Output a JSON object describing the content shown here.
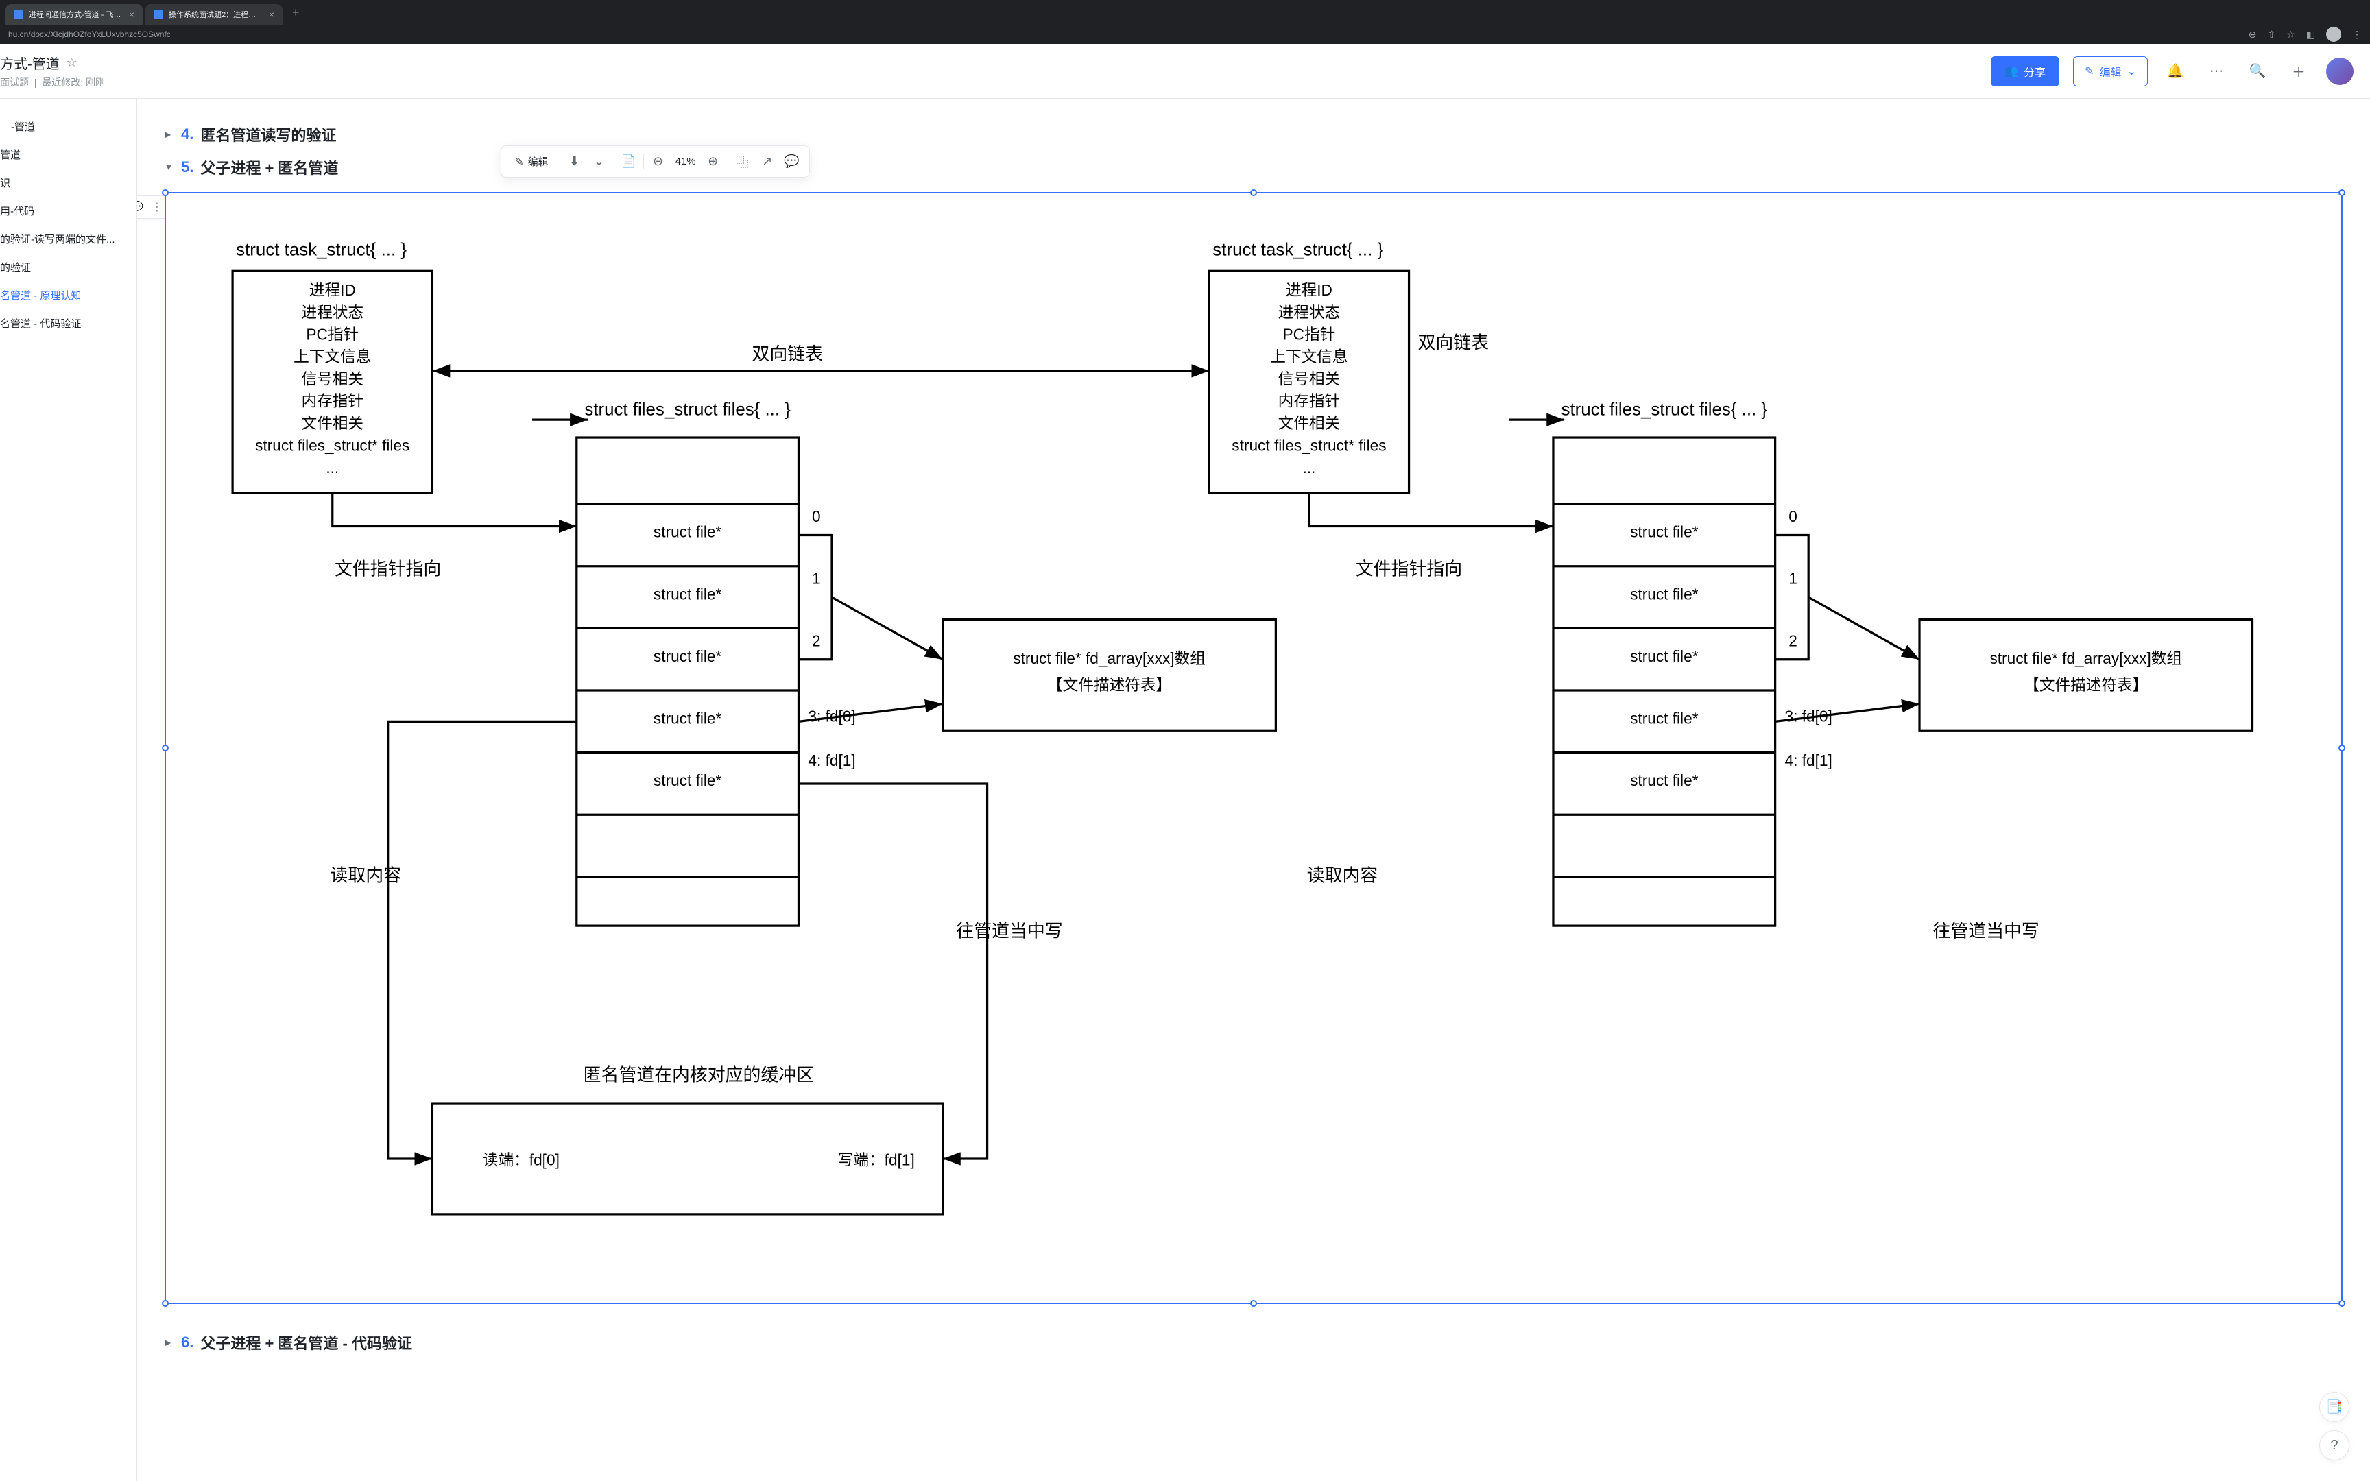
{
  "browser": {
    "tabs": [
      {
        "title": "进程间通信方式-管道 - 飞书云文档",
        "active": true
      },
      {
        "title": "操作系统面试题2：进程间通信方式",
        "active": false
      }
    ],
    "url": "hu.cn/docx/XIcjdhOZfoYxLUxvbhzc5OSwnfc"
  },
  "header": {
    "doc_title": "方式-管道",
    "meta_left": "面试题",
    "meta_right": "最近修改: 刚刚",
    "share": "分享",
    "edit": "编辑"
  },
  "toc": {
    "items": [
      {
        "label": "-管道",
        "active": false
      },
      {
        "label": "管道",
        "active": false
      },
      {
        "label": "识",
        "active": false
      },
      {
        "label": "用-代码",
        "active": false
      },
      {
        "label": "的验证-读写两端的文件...",
        "active": false
      },
      {
        "label": "的验证",
        "active": false
      },
      {
        "label": "名管道 - 原理认知",
        "active": true
      },
      {
        "label": "名管道 - 代码验证",
        "active": false
      }
    ]
  },
  "sections": {
    "s4_num": "4.",
    "s4_text": "匿名管道读写的验证",
    "s5_num": "5.",
    "s5_text": "父子进程 + 匿名管道",
    "s6_num": "6.",
    "s6_text": "父子进程 + 匿名管道 - 代码验证"
  },
  "toolbar": {
    "edit": "编辑",
    "zoom": "41%"
  },
  "diagram": {
    "task_struct_label": "struct task_struct{ ... }",
    "task_struct_fields": [
      "进程ID",
      "进程状态",
      "PC指针",
      "上下文信息",
      "信号相关",
      "内存指针",
      "文件相关",
      "struct files_struct* files",
      "..."
    ],
    "bidir_list": "双向链表",
    "files_struct_label": "struct files_struct files{ ... }",
    "file_ptr_point": "文件指针指向",
    "struct_file": "struct file*",
    "fd_array_label": "struct file* fd_array[xxx]数组",
    "fd_array_sub": "【文件描述符表】",
    "idx_0": "0",
    "idx_1": "1",
    "idx_2": "2",
    "idx_3": "3: fd[0]",
    "idx_4": "4: fd[1]",
    "read_content": "读取内容",
    "write_pipe": "往管道当中写",
    "pipe_buffer": "匿名管道在内核对应的缓冲区",
    "read_end": "读端：fd[0]",
    "write_end": "写端：fd[1]"
  }
}
